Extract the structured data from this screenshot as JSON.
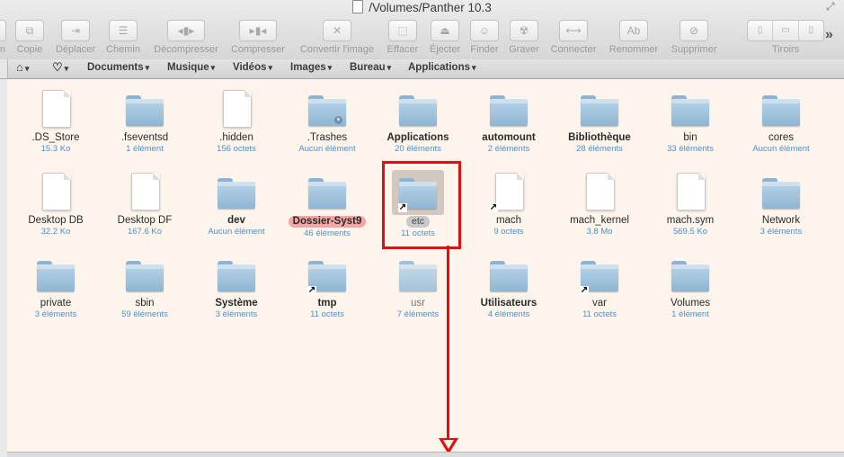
{
  "window": {
    "title": "/Volumes/Panther 10.3"
  },
  "toolbar": {
    "buttons": [
      {
        "label": "n",
        "icon": "partial-icon"
      },
      {
        "label": "Copie",
        "icon": "copy-icon"
      },
      {
        "label": "Déplacer",
        "icon": "move-icon"
      },
      {
        "label": "Chemin",
        "icon": "path-icon"
      },
      {
        "label": "Décompresser",
        "icon": "decompress-icon"
      },
      {
        "label": "Compresser",
        "icon": "compress-icon"
      },
      {
        "label": "Convertir l'image",
        "icon": "convert-icon"
      },
      {
        "label": "Effacer",
        "icon": "erase-icon"
      },
      {
        "label": "Éjecter",
        "icon": "eject-icon"
      },
      {
        "label": "Finder",
        "icon": "finder-icon"
      },
      {
        "label": "Graver",
        "icon": "burn-icon"
      },
      {
        "label": "Connecter",
        "icon": "connect-icon"
      },
      {
        "label": "Renommer",
        "icon": "rename-icon"
      },
      {
        "label": "Supprimer",
        "icon": "delete-icon"
      }
    ],
    "drawers_label": "Tiroirs"
  },
  "bookmarks": [
    {
      "label": "Documents"
    },
    {
      "label": "Musique"
    },
    {
      "label": "Vidéos"
    },
    {
      "label": "Images"
    },
    {
      "label": "Bureau"
    },
    {
      "label": "Applications"
    }
  ],
  "files": [
    {
      "name": ".DS_Store",
      "info": "15.3 Ko",
      "kind": "doc"
    },
    {
      "name": ".fseventsd",
      "info": "1 élément",
      "kind": "folder"
    },
    {
      "name": ".hidden",
      "info": "156 octets",
      "kind": "doc"
    },
    {
      "name": ".Trashes",
      "info": "Aucun élément",
      "kind": "folder"
    },
    {
      "name": "Applications",
      "info": "20 éléments",
      "kind": "folder"
    },
    {
      "name": "automount",
      "info": "2 éléments",
      "kind": "folder"
    },
    {
      "name": "Bibliothèque",
      "info": "28 éléments",
      "kind": "folder"
    },
    {
      "name": "bin",
      "info": "33 éléments",
      "kind": "folder"
    },
    {
      "name": "cores",
      "info": "Aucun élément",
      "kind": "folder"
    },
    {
      "name": "Desktop DB",
      "info": "32.2 Ko",
      "kind": "doc"
    },
    {
      "name": "Desktop DF",
      "info": "167.6 Ko",
      "kind": "doc"
    },
    {
      "name": "dev",
      "info": "Aucun élément",
      "kind": "folder"
    },
    {
      "name": "Dossier-Syst9",
      "info": "46 éléments",
      "kind": "folder"
    },
    {
      "name": "etc",
      "info": "11 octets",
      "kind": "folder"
    },
    {
      "name": "mach",
      "info": "9 octets",
      "kind": "doc"
    },
    {
      "name": "mach_kernel",
      "info": "3.8 Mo",
      "kind": "doc"
    },
    {
      "name": "mach.sym",
      "info": "569.5 Ko",
      "kind": "doc"
    },
    {
      "name": "Network",
      "info": "3 éléments",
      "kind": "folder"
    },
    {
      "name": "private",
      "info": "3 éléments",
      "kind": "folder"
    },
    {
      "name": "sbin",
      "info": "59 éléments",
      "kind": "folder"
    },
    {
      "name": "Système",
      "info": "3 éléments",
      "kind": "folder"
    },
    {
      "name": "tmp",
      "info": "11 octets",
      "kind": "folder"
    },
    {
      "name": "usr",
      "info": "7 éléments",
      "kind": "folder"
    },
    {
      "name": "Utilisateurs",
      "info": "4 éléments",
      "kind": "folder"
    },
    {
      "name": "var",
      "info": "11 octets",
      "kind": "folder"
    },
    {
      "name": "Volumes",
      "info": "1 élément",
      "kind": "folder"
    }
  ],
  "colors": {
    "background": "#fdf5eb",
    "info_text": "#4a90d0",
    "annotation": "#e01010",
    "label_red": "#f2a6a6"
  }
}
